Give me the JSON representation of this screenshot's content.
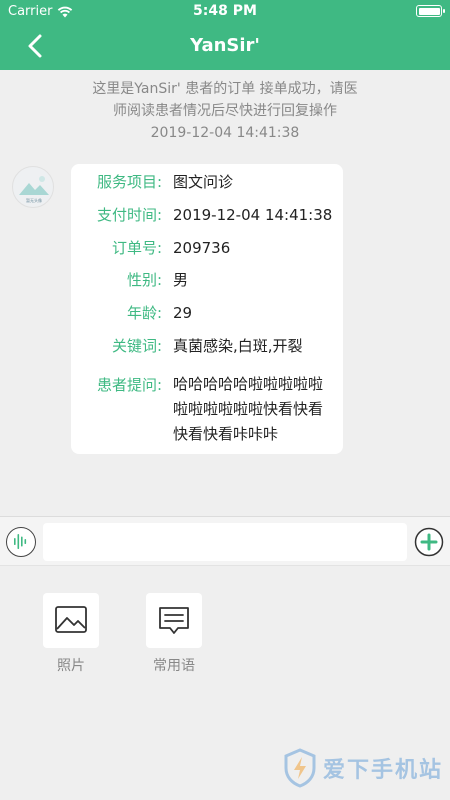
{
  "status_bar": {
    "carrier": "Carrier",
    "time": "5:48 PM"
  },
  "header": {
    "title": "YanSir'"
  },
  "notice": {
    "line1": "这里是YanSir' 患者的订单 接单成功，请医",
    "line2": "师阅读患者情况后尽快进行回复操作",
    "timestamp": "2019-12-04 14:41:38"
  },
  "avatar": {
    "caption": "暂无头像"
  },
  "order_card": {
    "rows": [
      {
        "label": "服务项目:",
        "value": "图文问诊"
      },
      {
        "label": "支付时间:",
        "value": "2019-12-04 14:41:38"
      },
      {
        "label": "订单号:",
        "value": "209736"
      },
      {
        "label": "性别:",
        "value": "男"
      },
      {
        "label": "年龄:",
        "value": "29"
      },
      {
        "label": "关键词:",
        "value": "真菌感染,白斑,开裂"
      },
      {
        "label": "患者提问:",
        "value": "哈哈哈哈哈啦啦啦啦啦啦啦啦啦啦啦快看快看快看快看咔咔咔"
      }
    ]
  },
  "input_bar": {
    "placeholder": ""
  },
  "tools": [
    {
      "label": "照片",
      "icon": "image-icon"
    },
    {
      "label": "常用语",
      "icon": "message-icon"
    }
  ],
  "watermark": {
    "text": "爱下手机站"
  },
  "colors": {
    "accent": "#3fb983",
    "background": "#efefef"
  }
}
